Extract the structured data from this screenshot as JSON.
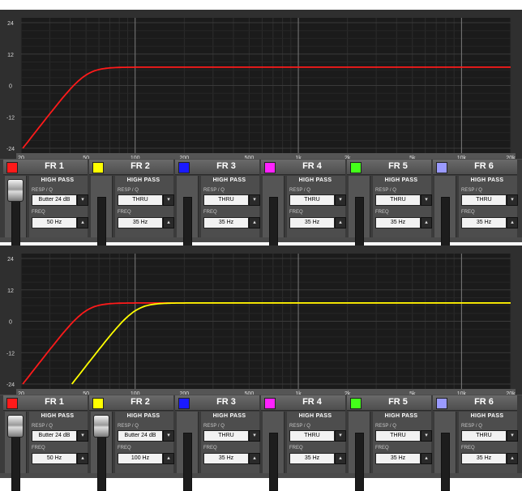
{
  "graph": {
    "y_ticks": [
      "24",
      "12",
      "0",
      "-12",
      "-24"
    ],
    "x_ticks": [
      "20",
      "50",
      "100",
      "200",
      "500",
      "1k",
      "2k",
      "5k",
      "10k",
      "20k"
    ]
  },
  "labels": {
    "high_pass": "HIGH PASS",
    "resp_q": "RESP / Q",
    "freq": "FREQ"
  },
  "colors": {
    "FR 1": "#ff1a1a",
    "FR 2": "#ffff00",
    "FR 3": "#1a1aff",
    "FR 4": "#ff22ff",
    "FR 5": "#44ff1a",
    "FR 6": "#9a9aff"
  },
  "views": [
    {
      "channels": [
        {
          "name": "FR 1",
          "resp": "Butter 24 dB",
          "freq": "50 Hz"
        },
        {
          "name": "FR 2",
          "resp": "THRU",
          "freq": "35 Hz"
        },
        {
          "name": "FR 3",
          "resp": "THRU",
          "freq": "35 Hz"
        },
        {
          "name": "FR 4",
          "resp": "THRU",
          "freq": "35 Hz"
        },
        {
          "name": "FR 5",
          "resp": "THRU",
          "freq": "35 Hz"
        },
        {
          "name": "FR 6",
          "resp": "THRU",
          "freq": "35 Hz"
        }
      ],
      "curves": [
        {
          "channel": "FR 1",
          "cutoff_hz": 50,
          "gain_db": 7
        }
      ]
    },
    {
      "channels": [
        {
          "name": "FR 1",
          "resp": "Butter 24 dB",
          "freq": "50 Hz"
        },
        {
          "name": "FR 2",
          "resp": "Butter 24 dB",
          "freq": "100 Hz"
        },
        {
          "name": "FR 3",
          "resp": "THRU",
          "freq": "35 Hz"
        },
        {
          "name": "FR 4",
          "resp": "THRU",
          "freq": "35 Hz"
        },
        {
          "name": "FR 5",
          "resp": "THRU",
          "freq": "35 Hz"
        },
        {
          "name": "FR 6",
          "resp": "THRU",
          "freq": "35 Hz"
        }
      ],
      "curves": [
        {
          "channel": "FR 1",
          "cutoff_hz": 50,
          "gain_db": 7
        },
        {
          "channel": "FR 2",
          "cutoff_hz": 100,
          "gain_db": 7
        }
      ]
    }
  ]
}
